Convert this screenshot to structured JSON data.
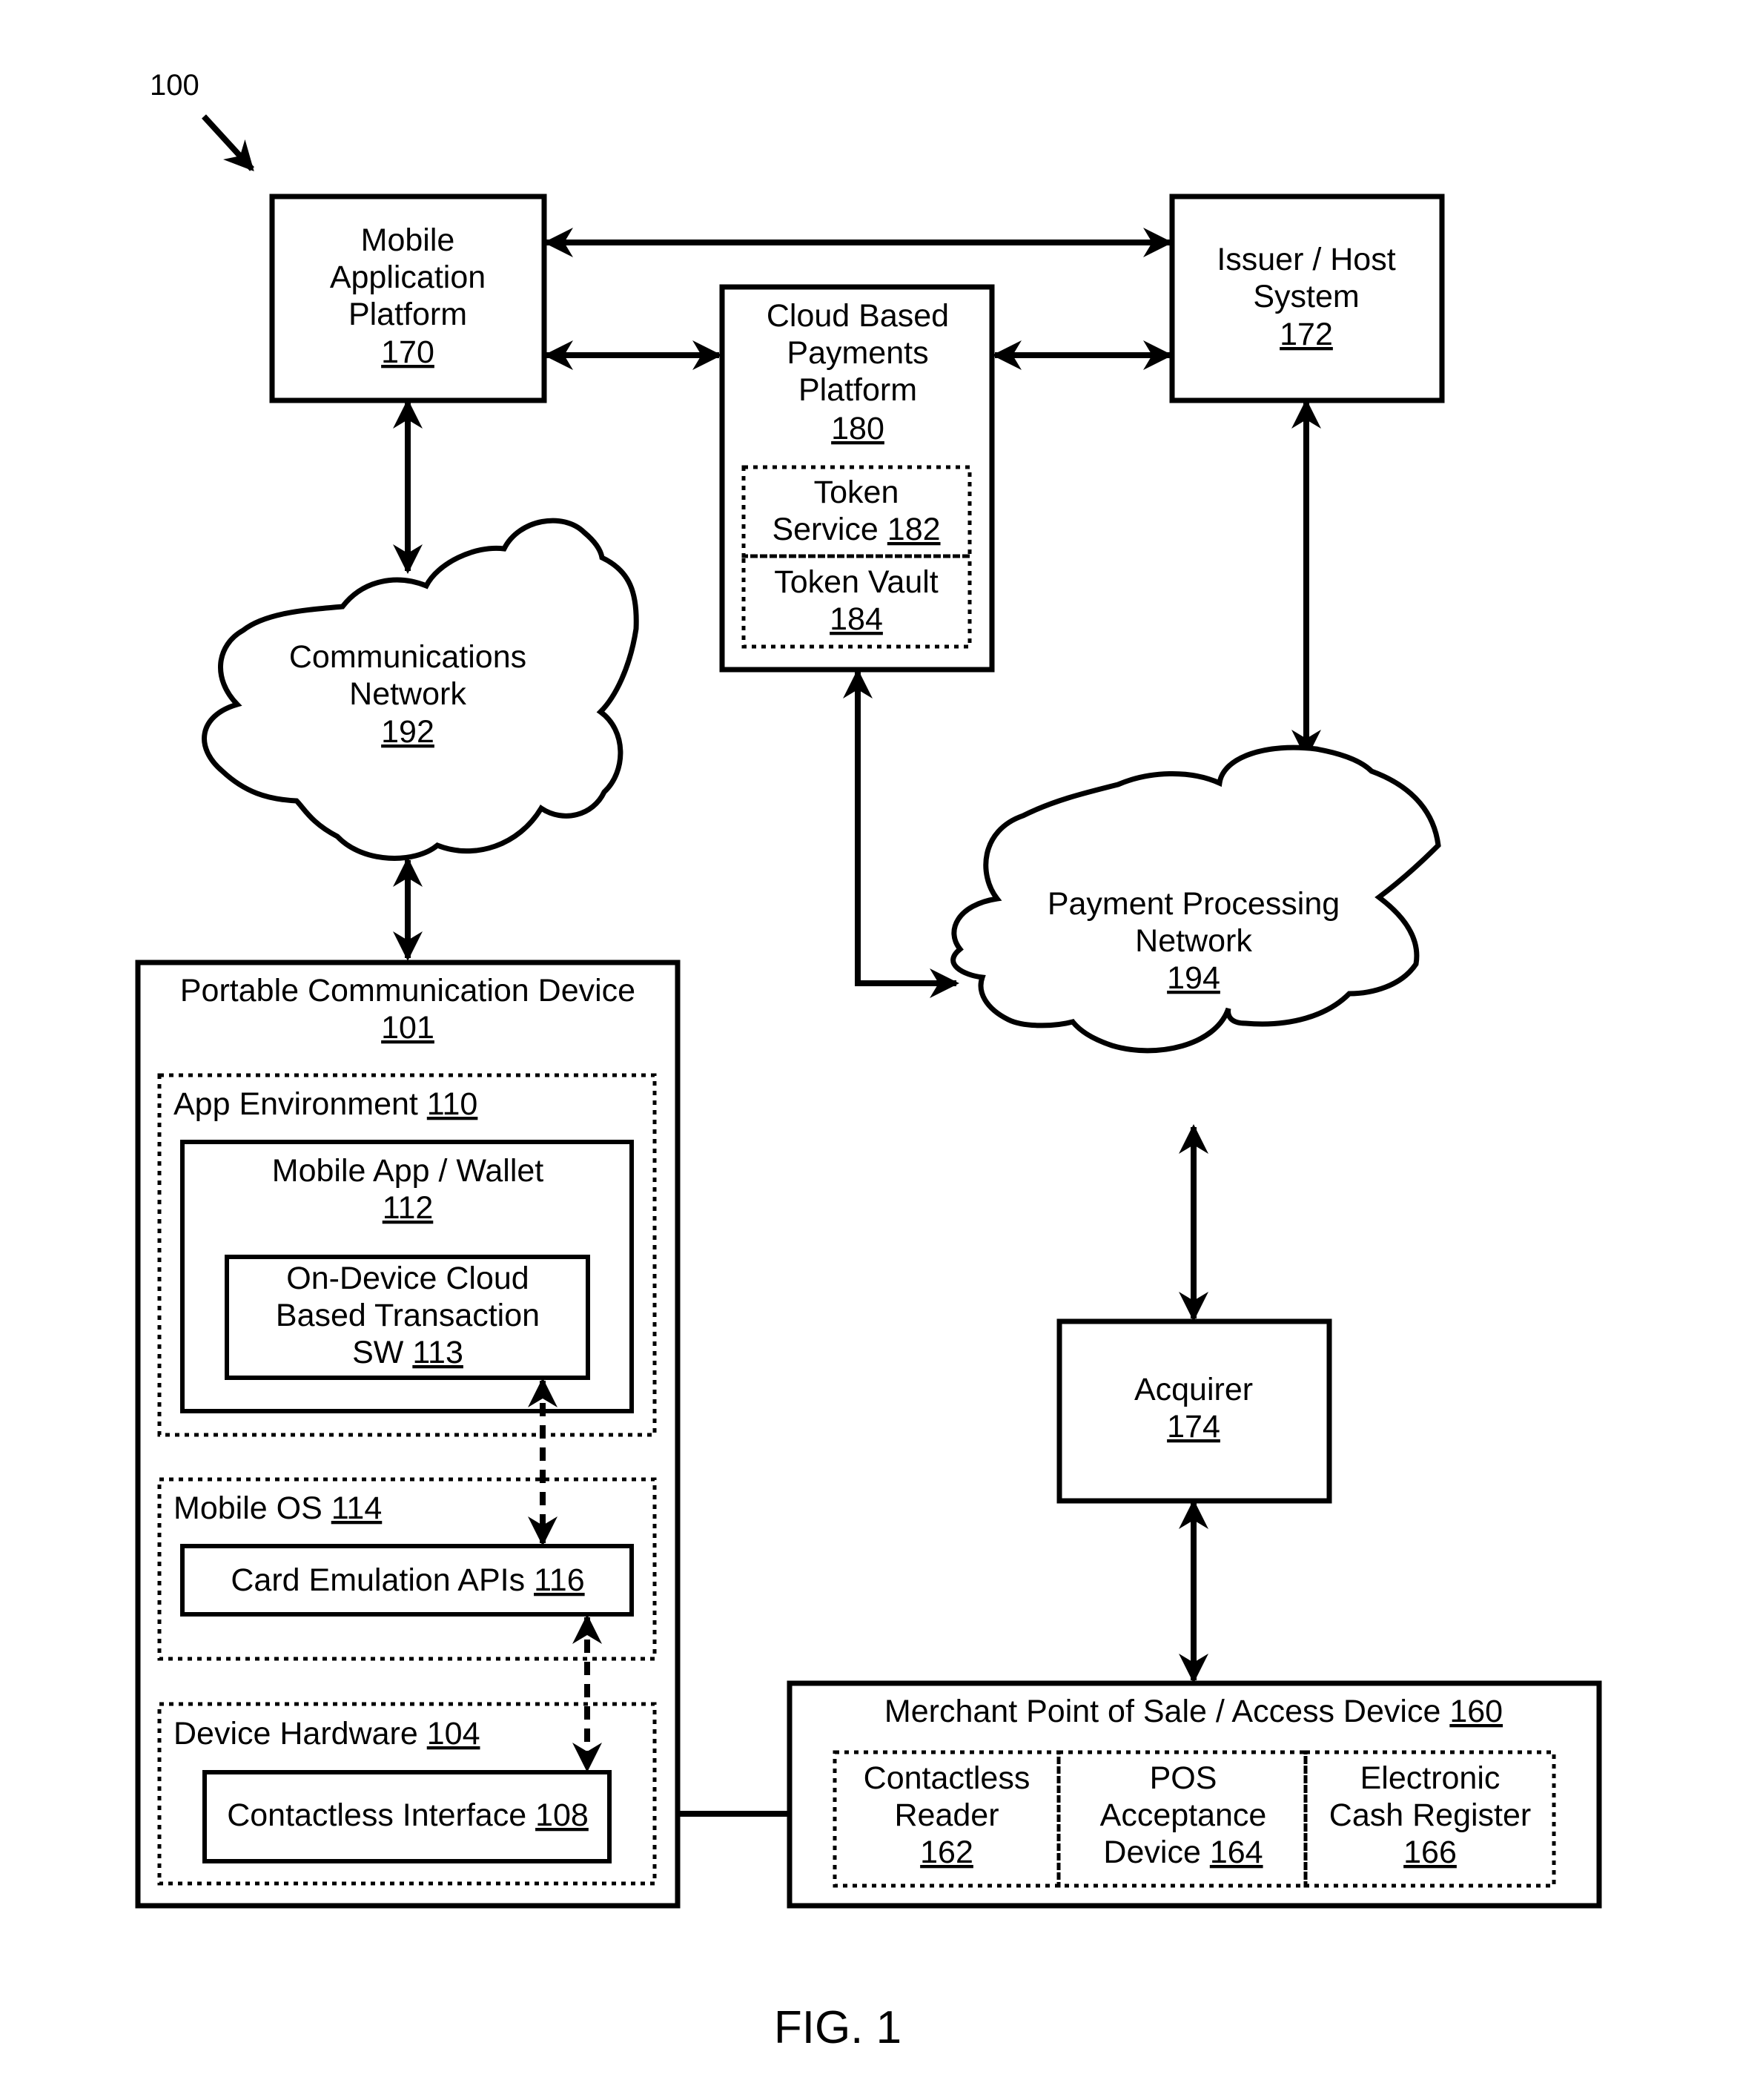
{
  "figure": {
    "ref_label": "100",
    "caption": "FIG. 1"
  },
  "nodes": {
    "mobile_app_platform": {
      "lines": [
        "Mobile",
        "Application",
        "Platform"
      ],
      "ref": "170"
    },
    "cloud_payments_platform": {
      "lines": [
        "Cloud Based",
        "Payments",
        "Platform"
      ],
      "ref": "180"
    },
    "token_service": {
      "line1": "Token",
      "line2_prefix": "Service ",
      "ref": "182"
    },
    "token_vault": {
      "line1": "Token Vault",
      "ref": "184"
    },
    "issuer_host": {
      "lines": [
        "Issuer / Host",
        "System"
      ],
      "ref": "172"
    },
    "communications_network": {
      "lines": [
        "Communications",
        "Network"
      ],
      "ref": "192"
    },
    "payment_processing_network": {
      "lines": [
        "Payment Processing",
        "Network"
      ],
      "ref": "194"
    },
    "portable_device": {
      "title": "Portable Communication Device",
      "ref": "101"
    },
    "app_environment": {
      "title": "App Environment ",
      "ref": "110"
    },
    "mobile_wallet": {
      "title": "Mobile App / Wallet",
      "ref": "112"
    },
    "on_device_sw": {
      "lines": [
        "On-Device Cloud",
        "Based Transaction"
      ],
      "line3_prefix": "SW ",
      "ref": "113"
    },
    "mobile_os": {
      "title": "Mobile OS ",
      "ref": "114"
    },
    "card_emulation": {
      "title": "Card Emulation APIs ",
      "ref": "116"
    },
    "device_hardware": {
      "title": "Device Hardware ",
      "ref": "104"
    },
    "contactless_interface": {
      "title": "Contactless Interface ",
      "ref": "108"
    },
    "acquirer": {
      "title": "Acquirer",
      "ref": "174"
    },
    "merchant_pos": {
      "title": "Merchant Point of Sale / Access Device ",
      "ref": "160"
    },
    "contactless_reader": {
      "lines": [
        "Contactless",
        "Reader"
      ],
      "ref": "162"
    },
    "pos_acceptance": {
      "lines": [
        "POS",
        "Acceptance"
      ],
      "line3_prefix": "Device ",
      "ref": "164"
    },
    "cash_register": {
      "lines": [
        "Electronic",
        "Cash Register"
      ],
      "ref": "166"
    }
  },
  "connections": [
    {
      "from": "mobile_app_platform",
      "to": "issuer_host",
      "style": "solid",
      "direction": "bidirectional"
    },
    {
      "from": "mobile_app_platform",
      "to": "cloud_payments_platform",
      "style": "solid",
      "direction": "bidirectional"
    },
    {
      "from": "cloud_payments_platform",
      "to": "issuer_host",
      "style": "solid",
      "direction": "bidirectional"
    },
    {
      "from": "mobile_app_platform",
      "to": "communications_network",
      "style": "solid",
      "direction": "bidirectional"
    },
    {
      "from": "communications_network",
      "to": "portable_device",
      "style": "solid",
      "direction": "bidirectional"
    },
    {
      "from": "issuer_host",
      "to": "payment_processing_network",
      "style": "solid",
      "direction": "bidirectional"
    },
    {
      "from": "cloud_payments_platform",
      "to": "payment_processing_network",
      "style": "solid",
      "direction": "bidirectional"
    },
    {
      "from": "payment_processing_network",
      "to": "acquirer",
      "style": "solid",
      "direction": "bidirectional"
    },
    {
      "from": "acquirer",
      "to": "merchant_pos",
      "style": "solid",
      "direction": "bidirectional"
    },
    {
      "from": "on_device_sw",
      "to": "card_emulation",
      "style": "dashed",
      "direction": "bidirectional"
    },
    {
      "from": "card_emulation",
      "to": "contactless_interface",
      "style": "dashed",
      "direction": "bidirectional"
    },
    {
      "from": "contactless_interface",
      "to": "contactless_reader",
      "style": "solid",
      "direction": "bidirectional"
    }
  ]
}
